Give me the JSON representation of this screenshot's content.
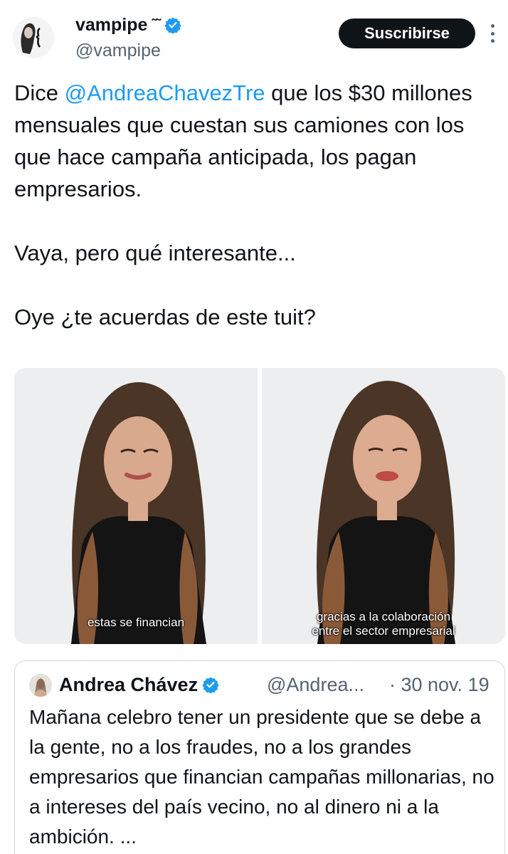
{
  "author": {
    "display_name": "vampipe",
    "name_decoration": "˜˜",
    "handle": "@vampipe",
    "avatar_icon": "avatar-silhouette-icon",
    "verified_icon": "verified-badge-icon",
    "verified_color": "#1d9bf0"
  },
  "actions": {
    "subscribe_label": "Suscribirse",
    "more_icon": "more-vertical-icon"
  },
  "tweet": {
    "line1_before": "Dice ",
    "mention": "@AndreaChavezTre",
    "line1_after": " que los $30 millones mensuales que cuestan sus camiones con los que hace campaña anticipada, los pagan empresarios.",
    "paragraph2": "Vaya, pero qué interesante...",
    "paragraph3": "Oye ¿te acuerdas de este tuit?"
  },
  "media": {
    "image1_caption": "estas se financian",
    "image2_caption_line1": "gracias a la colaboración",
    "image2_caption_line2": "entre el sector empresarial"
  },
  "quoted_tweet": {
    "display_name": "Andrea Chávez",
    "handle": "@Andrea...",
    "date": "· 30 nov. 19",
    "text": "Mañana celebro tener un presidente que se debe a la gente, no a los fraudes, no a los grandes empresarios que financian campañas millonarias, no a intereses del país vecino, no al dinero ni a la ambición. ...",
    "avatar_icon": "avatar-icon"
  },
  "colors": {
    "link": "#1d9bf0",
    "secondary_text": "#536471",
    "button_bg": "#0f1419"
  }
}
